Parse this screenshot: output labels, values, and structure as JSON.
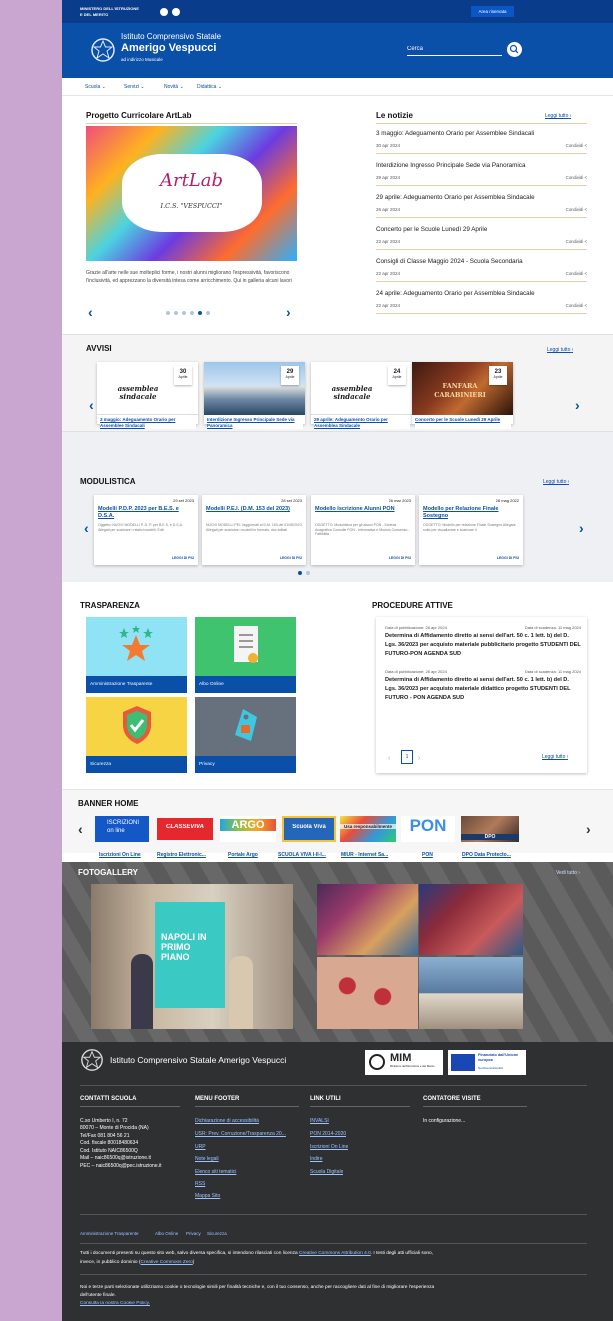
{
  "topbar": {
    "ministry_line1": "MINISTERO DELL'ISTRUZIONE",
    "ministry_line2": "E DEL MERITO",
    "reserved_area": "Area riservata"
  },
  "header": {
    "school_type": "Istituto Comprensivo Statale",
    "school_name": "Amerigo Vespucci",
    "school_sub": "ad indirizzo Musicale",
    "search_placeholder": "Cerca"
  },
  "nav": {
    "items": [
      {
        "label": "Scuola"
      },
      {
        "label": "Servizi"
      },
      {
        "label": "Novità"
      },
      {
        "label": "Didattica"
      }
    ]
  },
  "artlab": {
    "title": "Progetto Curricolare ArtLab",
    "logo_text": "ArtLab",
    "logo_sub": "I.C.S. \"VESPUCCI\"",
    "caption": "Grazie all'arte nelle sue molteplici forme, i nostri alunni migliorano l'espressività, favoriscono l'inclusività, ed apprezzano la diversità intesa come arricchimento. Qui in galleria alcuni lavori"
  },
  "news": {
    "title": "Le notizie",
    "read_all": "Leggi tutto",
    "share_label": "Condividi",
    "items": [
      {
        "title": "3 maggio: Adeguamento Orario per Assemblee Sindacali",
        "date": "30 apr 2024"
      },
      {
        "title": "Interdizione Ingresso Principale Sede via Panoramica",
        "date": "29 apr 2024"
      },
      {
        "title": "29 aprile: Adeguamento Orario per Assemblea Sindacale",
        "date": "26 apr 2024"
      },
      {
        "title": "Concerto per le Scuole Lunedì 29 Aprile",
        "date": "23 apr 2024"
      },
      {
        "title": "Consigli di Classe Maggio 2024 - Scuola Secondaria",
        "date": "22 apr 2024"
      },
      {
        "title": "24 aprile: Adeguamento Orario per Assemblea Sindacale",
        "date": "22 apr 2024"
      }
    ]
  },
  "avvisi": {
    "title": "AVVISI",
    "read_all": "Leggi tutto",
    "items": [
      {
        "day": "30",
        "month": "Aprile",
        "title": "3 maggio: Adeguamento Orario per Assemblee Sindacali",
        "img_text": "assemblea sindacale"
      },
      {
        "day": "29",
        "month": "Aprile",
        "title": "Interdizione Ingresso Principale Sede via Panoramica",
        "img_text": ""
      },
      {
        "day": "24",
        "month": "Aprile",
        "title": "29 aprile: Adeguamento Orario per Assemblea Sindacale",
        "img_text": "assemblea sindacale"
      },
      {
        "day": "23",
        "month": "Aprile",
        "title": "Concerto per le Scuole Lunedì 29 Aprile",
        "img_text": "FANFARA CARABINIERI"
      }
    ]
  },
  "modulistica": {
    "title": "MODULISTICA",
    "read_all": "Leggi tutto",
    "more_label": "LEGGI DI PIÙ",
    "items": [
      {
        "date": "29 set 2023",
        "title": "Modelli P.D.P. 2023 per B.E.S. e D.S.A.",
        "desc": "Oggetto: NUOVI MODELLI P. D. P. per B.E.S. e D.S.A. Allegati per scaricare i relativi modelli. Edit"
      },
      {
        "date": "28 set 2023",
        "title": "Modelli P.E.I. (D.M. 153 del 2023)",
        "desc": "NUOVI MODELLI PEI: l'aggiornati al D.M. 153 del 01/08/2023 Allegati per scaricare i modelli in formato. doc editati"
      },
      {
        "date": "26 mar 2023",
        "title": "Modello Iscrizione Alunni PON",
        "desc": "OGGETTO: Modulistica per gli alunni PON - Scheda Anagrafica Consolle PON - Informativa e Modulo Consenso - Fattibilità"
      },
      {
        "date": "28 mag 2022",
        "title": "Modello per Relazione Finale Sostegno",
        "desc": "OGGETTO: Modello per relazione Finale Sostegno Allegare sotto per visualizzare e scaricare il"
      }
    ]
  },
  "trasparenza": {
    "title": "TRASPARENZA",
    "tiles": [
      {
        "label": "Amministrazione Trasparente"
      },
      {
        "label": "Albo Online"
      },
      {
        "label": "Sicurezza"
      },
      {
        "label": "Privacy"
      }
    ]
  },
  "procedure": {
    "title": "PROCEDURE ATTIVE",
    "read_all": "Leggi tutto",
    "page": "1",
    "items": [
      {
        "pub": "Data di pubblicazione: 26 apr 2024",
        "exp": "Data di scadenza: 11 mag 2024",
        "title": "Determina di Affidamento diretto ai sensi dell'art. 50 c. 1 lett. b) del D. Lgs. 36/2023 per acquisto materiale pubblicitario progetto STUDENTI DEL FUTURO-PON AGENDA SUD"
      },
      {
        "pub": "Data di pubblicazione: 26 apr 2024",
        "exp": "Data di scadenza: 11 mag 2024",
        "title": "Determina di Affidamento diretto ai sensi dell'art. 50 c. 1 lett. b) del D. Lgs. 36/2023 per acquisto materiale didattico progetto STUDENTI DEL FUTURO - PON AGENDA SUD"
      }
    ]
  },
  "banner": {
    "title": "BANNER HOME",
    "items": [
      {
        "label": "Iscrizioni On Line",
        "art": "ISCRIZIONI on line"
      },
      {
        "label": "Registro Elettronic...",
        "art": "CLASSEVIVA"
      },
      {
        "label": "Portale Argo",
        "art": "ARGO"
      },
      {
        "label": "SCUOLA VIVA I-II-I...",
        "art": "Scuola Viva"
      },
      {
        "label": "MIUR - Internet Sa...",
        "art": "Usa responsabilmente"
      },
      {
        "label": "PON",
        "art": "PON"
      },
      {
        "label": "DPO Data Protecto...",
        "art": "DPO"
      }
    ]
  },
  "gallery": {
    "title": "FOTOGALLERY",
    "read_all": "Vedi tutto",
    "poster_text": "NAPOLI IN PRIMO PIANO"
  },
  "footer": {
    "school": "Istituto Comprensivo Statale Amerigo Vespucci",
    "mim": "MIM",
    "mim_sub": "Ministero dell'Istruzione e del Merito",
    "eu": "Finanziato dall'Unione europea",
    "eu_sub": "NextGenerationEU",
    "contacts_title": "CONTATTI SCUOLA",
    "contacts": [
      "C.so Umberto I, n. 72",
      "80070 – Monte di Procida (NA)",
      "Tel/Fax 081 804 56 21",
      "Cod. fiscale 80018480634",
      "Cod. Istituto NAIC86500Q",
      "Mail – naic86500q@istruzione.it",
      "PEC – naic86500q@pec.istruzione.it"
    ],
    "menu_title": "MENU FOOTER",
    "menu": [
      "Dichiarazione di accessibilità",
      "USR: Prev. Corruzione/Trasparenza 20...",
      "URP",
      "Note legali",
      "Elenco siti tematici",
      "RSS",
      "Mappa Sito"
    ],
    "links_title": "LINK UTILI",
    "links": [
      "INVALSI",
      "PON 2014-2020",
      "Iscrizioni On Line",
      "Indire",
      "Scuola Digitale"
    ],
    "counter_title": "CONTATORE VISITE",
    "counter_text": "In configurazione...",
    "bottom_links": [
      "Amministrazione Trasparente",
      "Albo Online",
      "Privacy",
      "Sicurezza"
    ],
    "license_pre": "Tutti i documenti presenti su questo sito web, salvo diversa specifica, si intendono rilasciati con licenza",
    "license_link": "Creative Commons Attribution 4.0",
    "license_mid": ". I testi degli atti ufficiali sono,",
    "license_line2_pre": "invece, in pubblico dominio (",
    "license_link2": "Creative Commons Zero",
    "license_line2_post": ")",
    "cookie_line1": "Noi e terze parti selezionate utilizziamo cookie o tecnologie simili per finalità tecniche e, con il tuo consenso, anche per raccogliere dati al fine di migliorare l'esperienza",
    "cookie_line2": "dell'utente finale.",
    "cookie_link": "Consulta la nostra Cookie Policy."
  }
}
